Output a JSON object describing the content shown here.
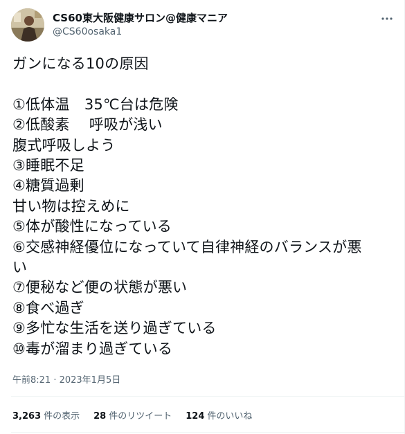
{
  "author": {
    "display_name": "CS60東大阪健康サロン@健康マニア",
    "handle": "@CS60osaka1",
    "avatar_icon": "user-avatar-icon"
  },
  "tweet": {
    "lines": [
      "ガンになる10の原因",
      "",
      "①低体温　35℃台は危険",
      "②低酸素　 呼吸が浅い",
      "腹式呼吸しよう",
      "③睡眠不足",
      "④糖質過剰",
      "甘い物は控えめに",
      "⑤体が酸性になっている",
      "⑥交感神経優位になっていて自律神経のバランスが悪",
      "い",
      "⑦便秘など便の状態が悪い",
      "⑧食べ過ぎ",
      "⑨多忙な生活を送り過ぎている",
      "⑩毒が溜まり過ぎている"
    ],
    "timestamp": "午前8:21 · 2023年1月5日"
  },
  "stats": {
    "views_count": "3,263",
    "views_label": "件の表示",
    "retweets_count": "28",
    "retweets_label": "件のリツイート",
    "likes_count": "124",
    "likes_label": "件のいいね"
  },
  "colors": {
    "text_primary": "#0f1419",
    "text_secondary": "#536471",
    "divider": "#eff3f4"
  }
}
